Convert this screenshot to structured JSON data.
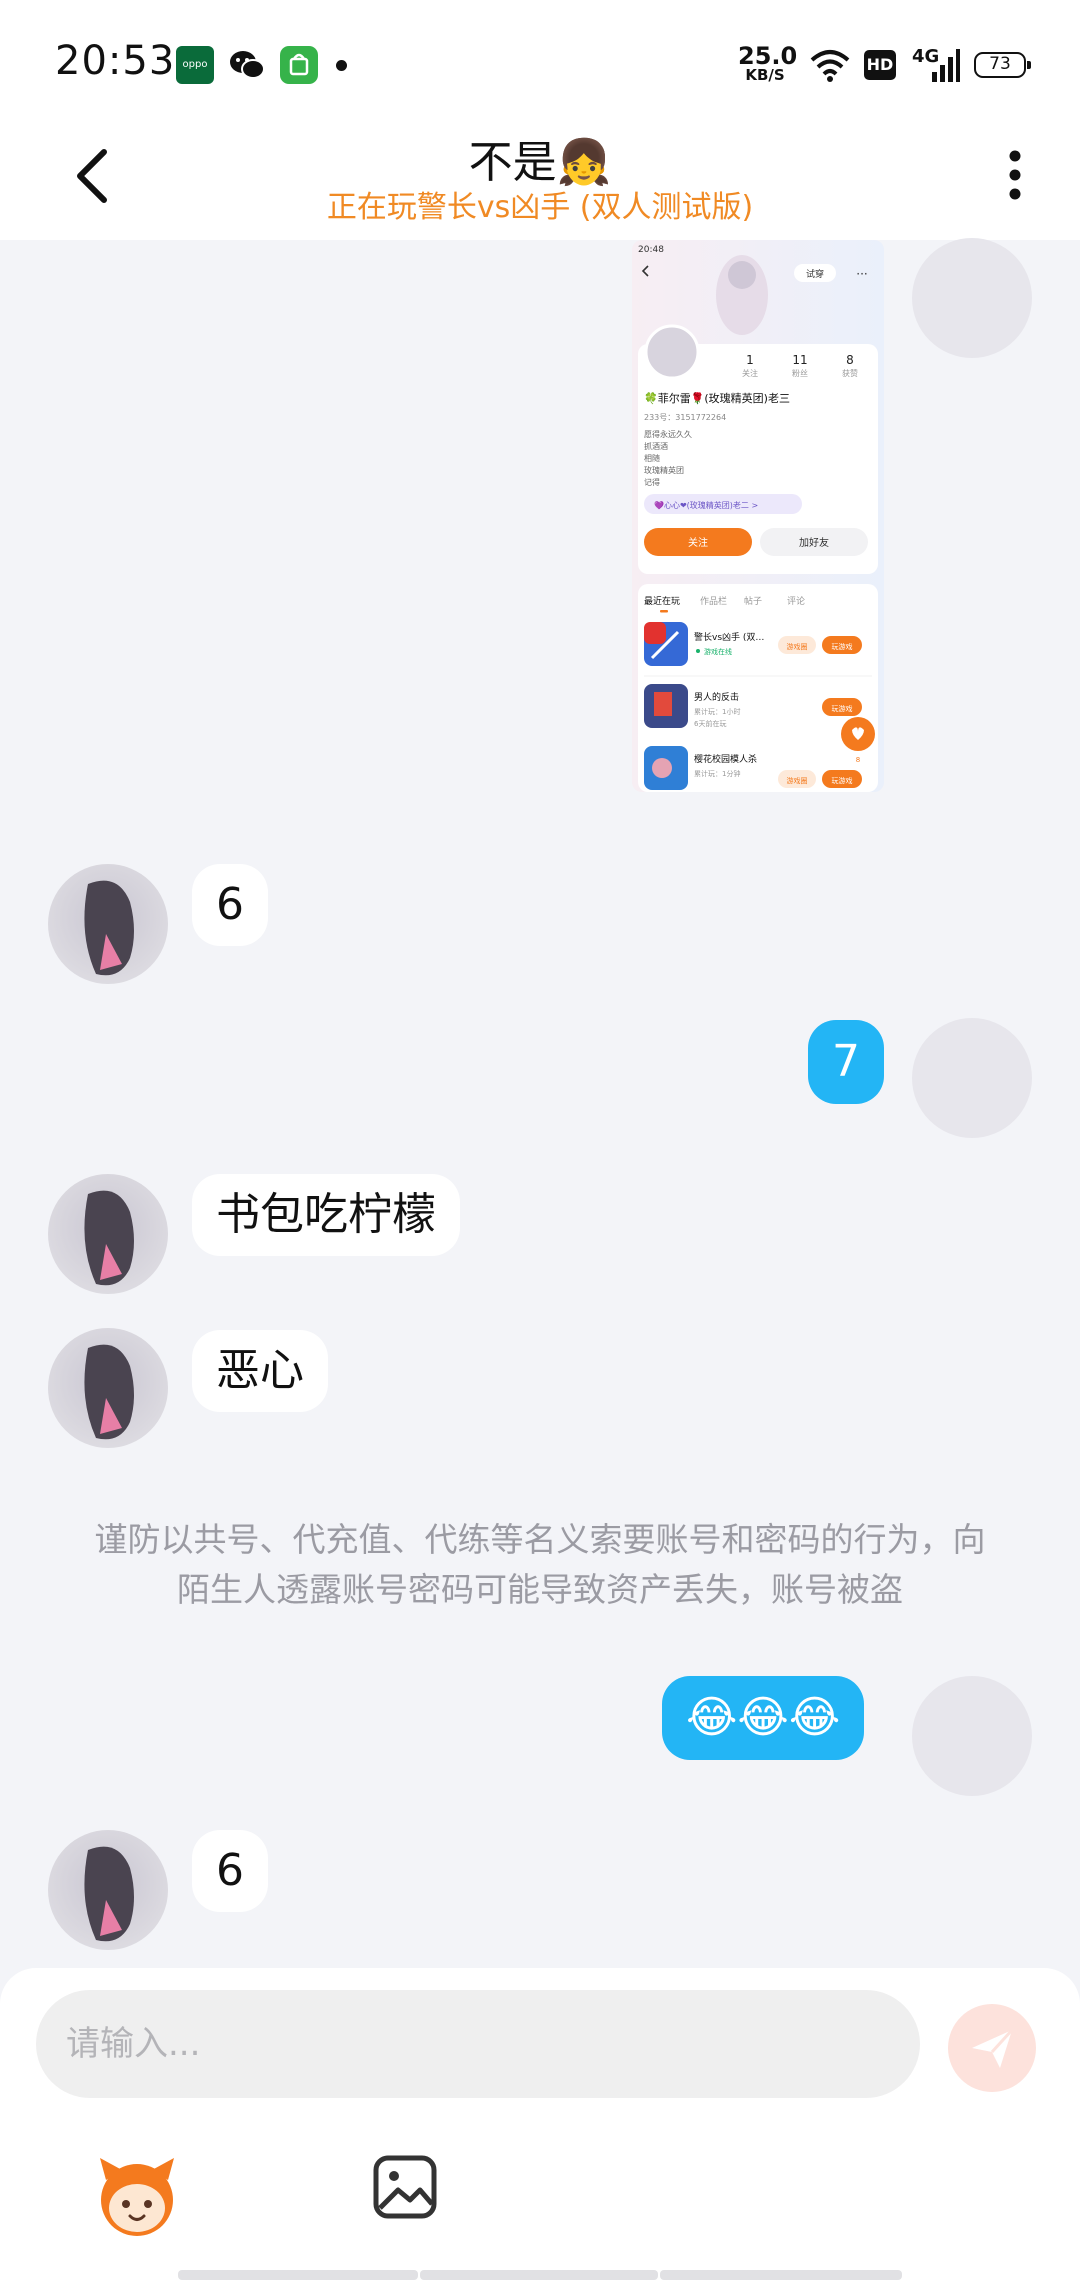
{
  "status_bar": {
    "time": "20:53",
    "app_icons": [
      "oppo-icon",
      "wechat-icon",
      "app-store-icon"
    ],
    "oppo_label": "oppo",
    "net_speed_value": "25.0",
    "net_speed_unit": "KB/S",
    "hd_label": "HD",
    "network_label": "4G",
    "battery": "73"
  },
  "header": {
    "title": "不是👧",
    "subtitle": "正在玩警长vs凶手 (双人测试版)"
  },
  "messages": [
    {
      "side": "self",
      "type": "image",
      "image_text": {
        "time": "20:48",
        "try_label": "试穿",
        "stats": [
          {
            "value": "1",
            "label": "关注"
          },
          {
            "value": "11",
            "label": "粉丝"
          },
          {
            "value": "8",
            "label": "获赞"
          }
        ],
        "name": "🍀菲尔雷🌹(玫瑰精英团)老三",
        "id_line": "233号：3151772264",
        "bio_lines": [
          "愿得永远久久",
          "抓酒酒",
          "相随",
          "玫瑰精英团",
          "记得"
        ],
        "group_tag": "💜心心❤(玫瑰精英团)老二 >",
        "follow_label": "关注",
        "add_friend_label": "加好友",
        "tabs": [
          "最近在玩",
          "作品栏",
          "帖子",
          "评论"
        ],
        "games": [
          {
            "name": "警长vs凶手 (双…",
            "status": "游戏在线",
            "btn1": "游戏圈",
            "btn2": "玩游戏"
          },
          {
            "name": "男人的反击",
            "status": "累计玩：1小时",
            "status2": "6天前在玩",
            "btn2": "玩游戏"
          },
          {
            "name": "樱花校园模人杀",
            "status": "累计玩：1分钟",
            "btn1": "游戏圈",
            "btn2": "玩游戏"
          }
        ],
        "like_count": "8"
      }
    },
    {
      "side": "other",
      "text": "6"
    },
    {
      "side": "self",
      "text": "7"
    },
    {
      "side": "other",
      "text": "书包吃柠檬"
    },
    {
      "side": "other",
      "text": "恶心"
    },
    {
      "side": "self",
      "text": "😂😂😂"
    },
    {
      "side": "other",
      "text": "6"
    }
  ],
  "notice": "谨防以共号、代充值、代练等名义索要账号和密码的行为，向陌生人透露账号密码可能导致资产丢失，账号被盗",
  "input": {
    "placeholder": "请输入..."
  },
  "colors": {
    "accent_orange": "#f08a24",
    "outgoing_bubble": "#23b5f5",
    "background": "#f3f4f8"
  }
}
